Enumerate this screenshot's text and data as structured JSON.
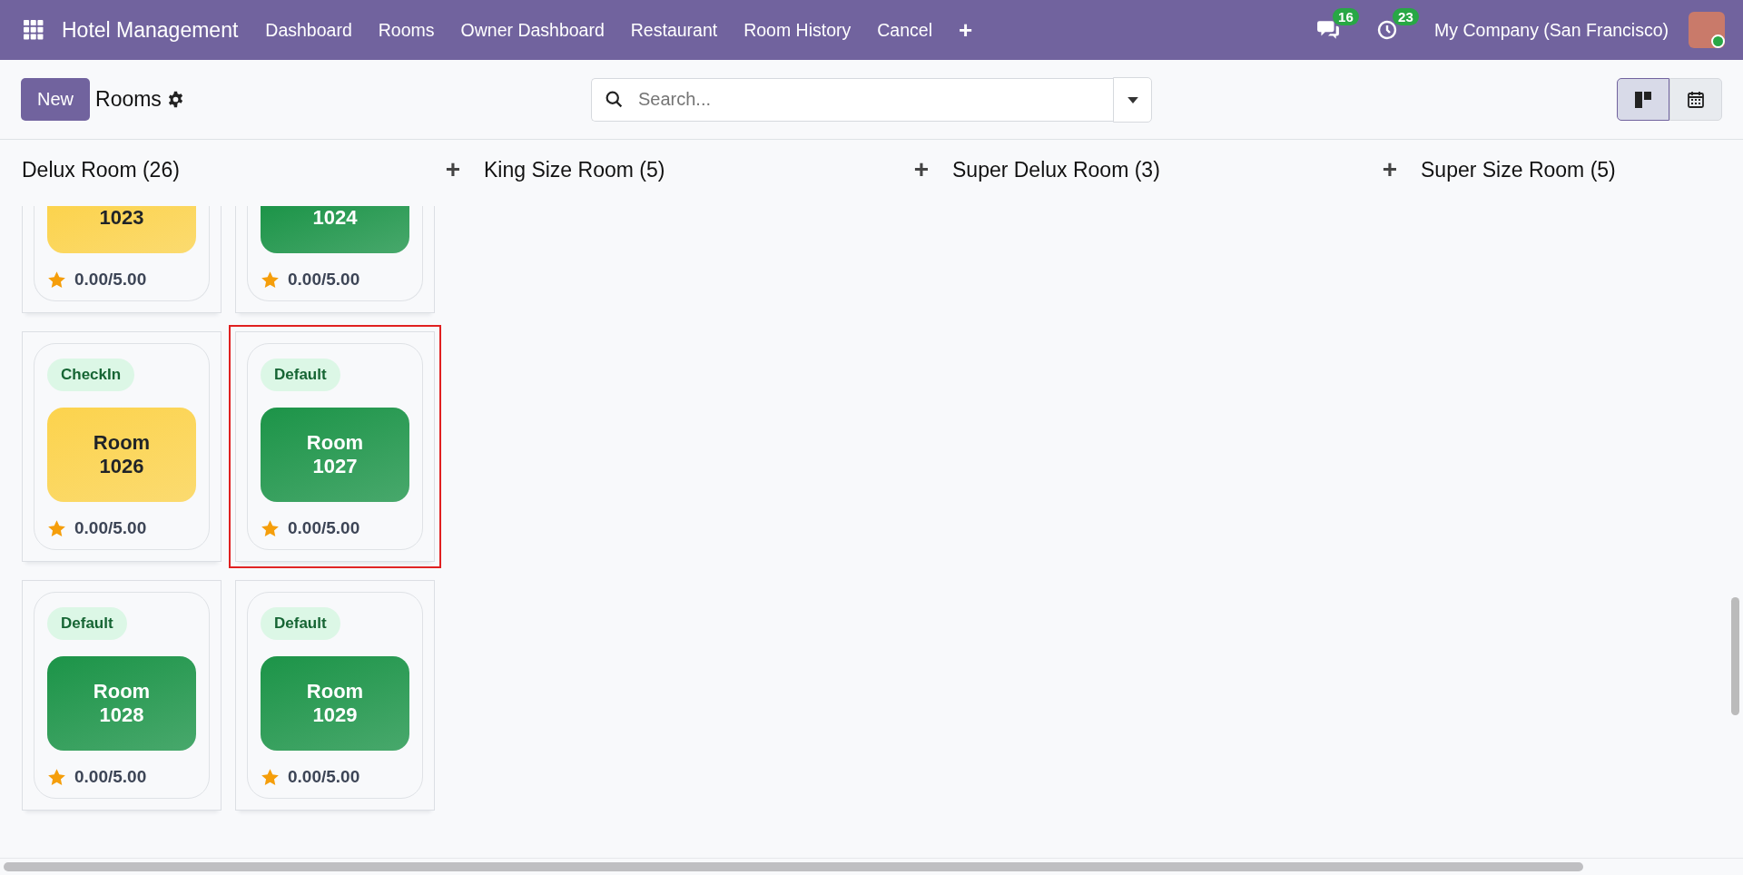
{
  "navbar": {
    "app_title": "Hotel Management",
    "menu": [
      "Dashboard",
      "Rooms",
      "Owner Dashboard",
      "Restaurant",
      "Room History",
      "Cancel"
    ],
    "add_menu": "+",
    "messages_count": "16",
    "activities_count": "23",
    "company": "My Company (San Francisco)"
  },
  "control_panel": {
    "new_button": "New",
    "title": "Rooms",
    "search": {
      "placeholder": "Search..."
    },
    "views": [
      {
        "kind": "kanban",
        "selected": true
      },
      {
        "kind": "calendar",
        "selected": false
      }
    ]
  },
  "columns": [
    {
      "title": "Delux Room (26)",
      "add": "+",
      "cards": [
        {
          "partial": true,
          "room": [
            "1023"
          ],
          "color": "#fcd34d",
          "rating": "0.00/5.00",
          "selected": false
        },
        {
          "partial": true,
          "room": [
            "1024"
          ],
          "color": "#1c9448",
          "rating": "0.00/5.00",
          "selected": false
        },
        {
          "partial": false,
          "tag": "CheckIn",
          "room": [
            "Room",
            "1026"
          ],
          "color": "#fcd34d",
          "rating": "0.00/5.00",
          "selected": false
        },
        {
          "partial": false,
          "tag": "Default",
          "room": [
            "Room",
            "1027"
          ],
          "color": "#1c9448",
          "rating": "0.00/5.00",
          "selected": true
        },
        {
          "partial": false,
          "tag": "Default",
          "room": [
            "Room",
            "1028"
          ],
          "color": "#1c9448",
          "rating": "0.00/5.00",
          "selected": false
        },
        {
          "partial": false,
          "tag": "Default",
          "room": [
            "Room",
            "1029"
          ],
          "color": "#1c9448",
          "rating": "0.00/5.00",
          "selected": false
        }
      ]
    },
    {
      "title": "King Size Room (5)",
      "add": "+"
    },
    {
      "title": "Super Delux Room (3)",
      "add": "+"
    },
    {
      "title": "Super Size Room (5)"
    }
  ]
}
